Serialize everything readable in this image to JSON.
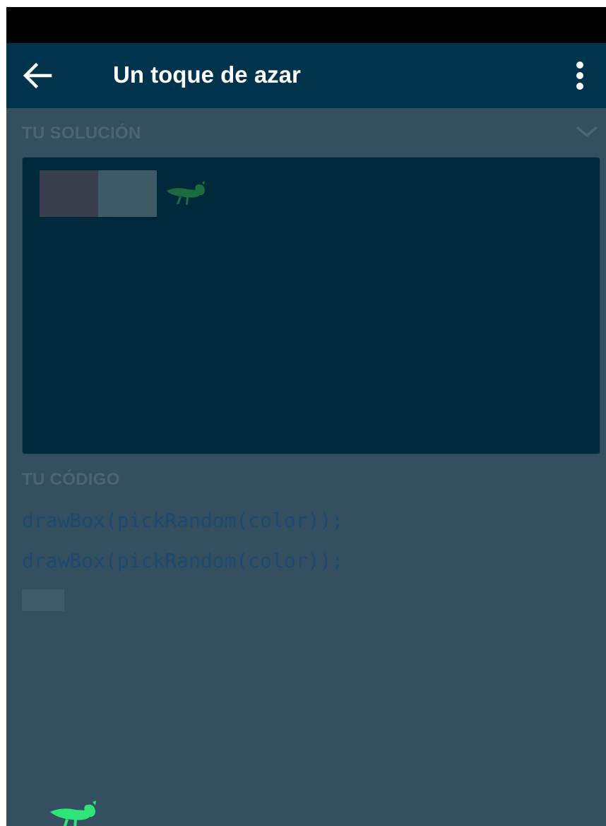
{
  "app_bar": {
    "title": "Un toque de azar",
    "back_icon": "arrow-left-icon",
    "overflow_icon": "more-vert-icon"
  },
  "solution": {
    "label": "TU SOLUCIÓN",
    "collapse_icon": "chevron-down-icon",
    "boxes": [
      {
        "color": "#3a3f4e"
      },
      {
        "color": "#3d5a66"
      }
    ],
    "mascot_icon": "grasshopper-icon"
  },
  "code": {
    "label": "TU CÓDIGO",
    "lines": [
      "drawBox(pickRandom(color));",
      "drawBox(pickRandom(color));"
    ]
  },
  "colors": {
    "app_bar": "#00344d",
    "background": "#344f60",
    "canvas": "#00283b",
    "grasshopper_dim": "#1c6b40",
    "grasshopper_bright": "#2ee57a",
    "code_text": "#1f4a70"
  },
  "footer": {
    "logo_icon": "grasshopper-icon"
  }
}
